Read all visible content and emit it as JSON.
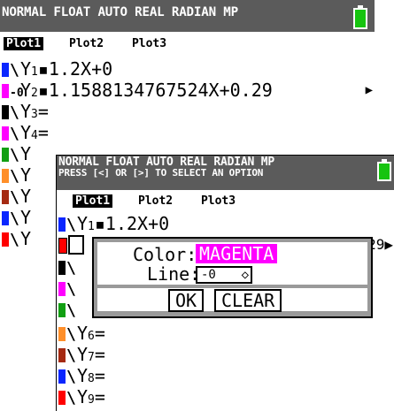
{
  "colors": {
    "status_bar": "#5b5b5b",
    "battery": "#16c40f",
    "blue": "#0a26ff",
    "magenta": "#ff00ff",
    "black": "#000000",
    "green": "#119f12",
    "orange": "#ff8f2a",
    "brown": "#a52a12",
    "red": "#ff0000"
  },
  "back": {
    "status_text": "NORMAL FLOAT AUTO REAL RADIAN MP",
    "plots": [
      "Plot1",
      "Plot2",
      "Plot3"
    ],
    "rows": [
      {
        "style": "\\",
        "y": "Y",
        "sub": "1",
        "eq": "▪",
        "expr": "1.2X+0",
        "arrow": ""
      },
      {
        "style": "-0",
        "y": "Y",
        "sub": "2",
        "eq": "▪",
        "expr": "1.1588134767524X+0.29",
        "arrow": "▶"
      },
      {
        "style": "\\",
        "y": "Y",
        "sub": "3",
        "eq": "=",
        "expr": "",
        "arrow": ""
      },
      {
        "style": "\\",
        "y": "Y",
        "sub": "4",
        "eq": "=",
        "expr": "",
        "arrow": ""
      },
      {
        "style": "\\",
        "y": "Y",
        "sub": "",
        "eq": "",
        "expr": "",
        "arrow": ""
      },
      {
        "style": "\\",
        "y": "Y",
        "sub": "",
        "eq": "",
        "expr": "",
        "arrow": ""
      },
      {
        "style": "\\",
        "y": "Y",
        "sub": "",
        "eq": "",
        "expr": "",
        "arrow": ""
      },
      {
        "style": "\\",
        "y": "Y",
        "sub": "",
        "eq": "",
        "expr": "",
        "arrow": ""
      },
      {
        "style": "\\",
        "y": "Y",
        "sub": "",
        "eq": "",
        "expr": "",
        "arrow": ""
      }
    ]
  },
  "front": {
    "status_text": "NORMAL FLOAT AUTO REAL RADIAN MP",
    "status_hint": "PRESS [<] OR [>] TO SELECT AN OPTION",
    "plots": [
      "Plot1",
      "Plot2",
      "Plot3"
    ],
    "row1": {
      "y": "Y",
      "sub": "1",
      "eq": "▪",
      "expr": "1.2X+0"
    },
    "row2_tail": "29▶",
    "dialog": {
      "color_label": "Color:",
      "color_value": "MAGENTA",
      "line_label": "Line:",
      "line_value": "-0",
      "line_arrows": "◇",
      "ok": "OK",
      "clear": "CLEAR"
    },
    "rows": [
      {
        "y": "Y",
        "sub": "6",
        "eq": "="
      },
      {
        "y": "Y",
        "sub": "7",
        "eq": "="
      },
      {
        "y": "Y",
        "sub": "8",
        "eq": "="
      },
      {
        "y": "Y",
        "sub": "9",
        "eq": "="
      }
    ]
  }
}
